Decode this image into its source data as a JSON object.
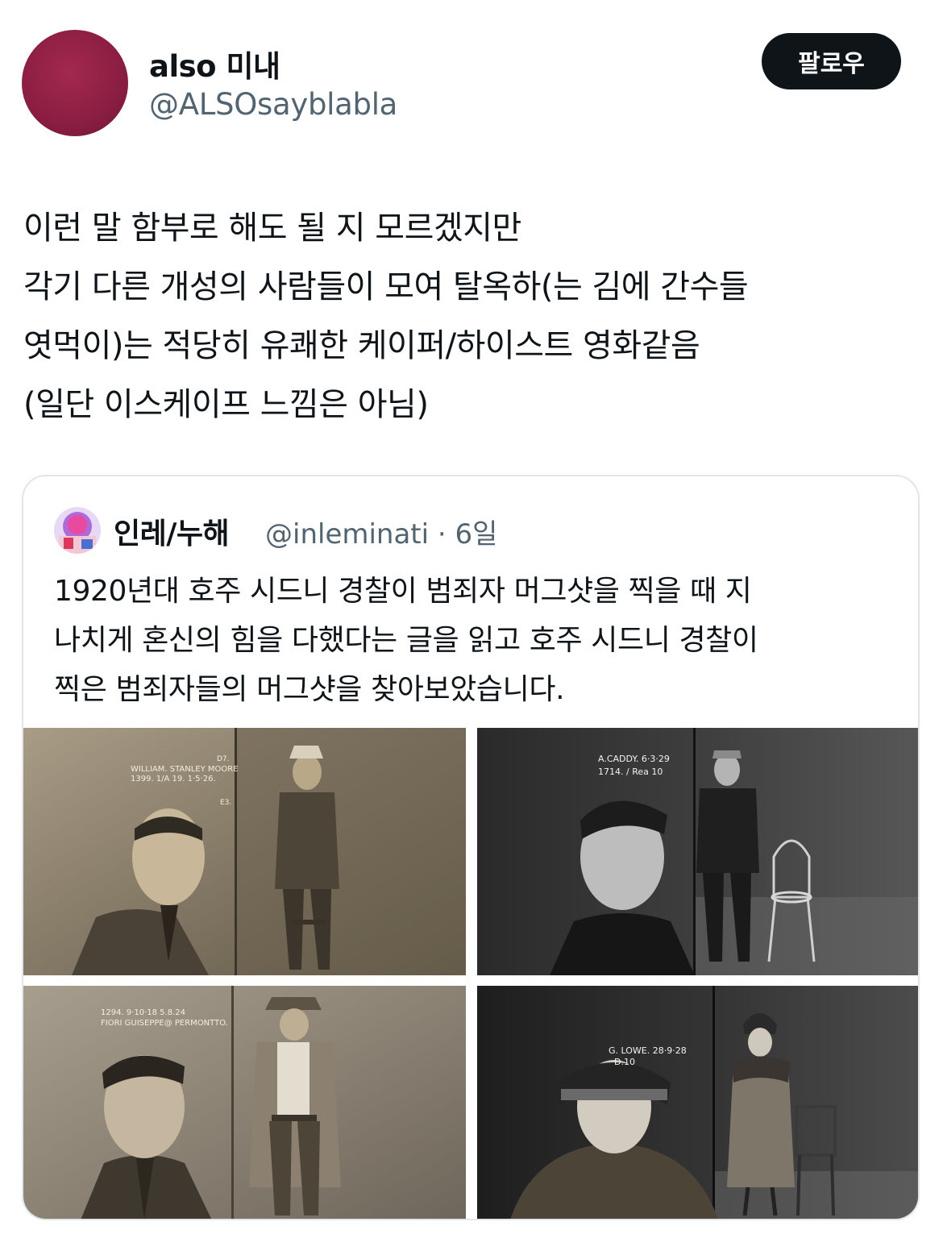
{
  "author": {
    "display_name": "also 미내",
    "handle": "@ALSOsayblabla",
    "avatar_color": "#8a1e42"
  },
  "follow_button_label": "팔로우",
  "tweet_lines": [
    "이런 말 함부로 해도 될 지 모르겠지만",
    "각기 다른 개성의 사람들이 모여 탈옥하(는 김에 간수들",
    "엿먹이)는 적당히 유쾌한 케이퍼/하이스트 영화같음",
    "(일단 이스케이프 느낌은 아님)"
  ],
  "quoted": {
    "display_name": "인레/누해",
    "handle": "@inleminati",
    "time": "6일",
    "text_lines": [
      "1920년대 호주 시드니 경찰이 범죄자 머그샷을 찍을 때 지",
      "나치게 혼신의 힘을 다했다는 글을 읽고 호주 시드니 경찰이",
      "찍은 범죄자들의 머그샷을 찾아보았습니다."
    ],
    "photos": [
      {
        "caption_line1": "WILLIAM. STANLEY MOORE",
        "caption_line2": "1399.  1/A 19.  1·5·26.",
        "caption_extra": "D7.",
        "caption_extra2": "E3."
      },
      {
        "caption_line1": "A.CADDY.  6·3·29",
        "caption_line2": "1714. / Rea 10",
        "caption_extra": "",
        "caption_extra2": ""
      },
      {
        "caption_line1": "1294.  9·10·18  5.8.24",
        "caption_line2": "FIORI GUISEPPE@ PERMONTTO.",
        "caption_extra": "",
        "caption_extra2": ""
      },
      {
        "caption_line1": "G. LOWE.  28·9·28",
        "caption_line2": "D.10",
        "caption_extra": "",
        "caption_extra2": ""
      }
    ]
  }
}
